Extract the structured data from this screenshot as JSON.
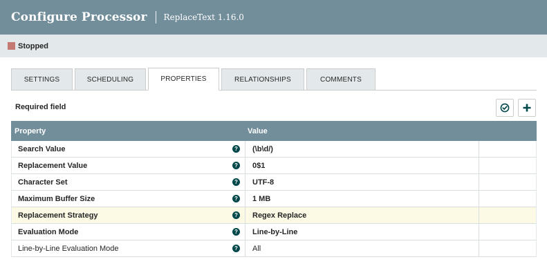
{
  "header": {
    "title": "Configure Processor",
    "subtitle": "ReplaceText 1.16.0"
  },
  "status": {
    "label": "Stopped",
    "color": "#ba554a"
  },
  "tabs": [
    {
      "label": "SETTINGS",
      "active": false
    },
    {
      "label": "SCHEDULING",
      "active": false
    },
    {
      "label": "PROPERTIES",
      "active": true
    },
    {
      "label": "RELATIONSHIPS",
      "active": false
    },
    {
      "label": "COMMENTS",
      "active": false
    }
  ],
  "properties_panel": {
    "required_label": "Required field",
    "verify_icon": "check-circle-icon",
    "add_icon": "plus-icon",
    "columns": {
      "property": "Property",
      "value": "Value"
    },
    "rows": [
      {
        "name": "Search Value",
        "value": "(\\b\\d/)",
        "required": true
      },
      {
        "name": "Replacement Value",
        "value": "0$1",
        "required": true
      },
      {
        "name": "Character Set",
        "value": "UTF-8",
        "required": true
      },
      {
        "name": "Maximum Buffer Size",
        "value": "1 MB",
        "required": true
      },
      {
        "name": "Replacement Strategy",
        "value": "Regex Replace",
        "required": true
      },
      {
        "name": "Evaluation Mode",
        "value": "Line-by-Line",
        "required": true
      },
      {
        "name": "Line-by-Line Evaluation Mode",
        "value": "All",
        "required": false
      }
    ]
  },
  "colors": {
    "header_bg": "#728e9b",
    "status_bg": "#e3e8eb",
    "highlight_row": "#fcf9e5",
    "help_icon": "#004849"
  }
}
